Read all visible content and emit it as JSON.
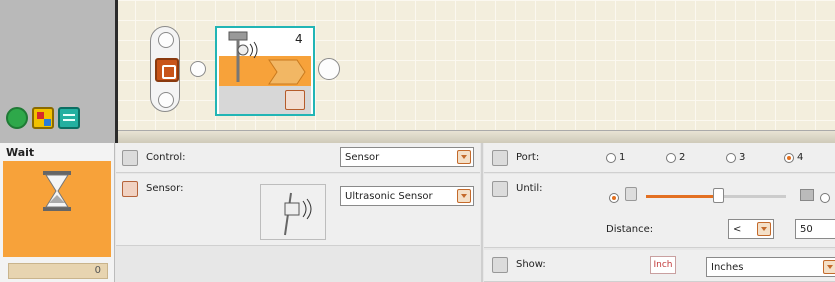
{
  "block": {
    "number": "4",
    "title": "Wait",
    "counter": "0"
  },
  "control": {
    "label": "Control:",
    "value": "Sensor"
  },
  "sensor": {
    "label": "Sensor:",
    "value": "Ultrasonic Sensor"
  },
  "port": {
    "label": "Port:",
    "options": [
      "1",
      "2",
      "3",
      "4"
    ],
    "selected": "4"
  },
  "until": {
    "label": "Until:",
    "distance_label": "Distance:",
    "comparator": "<",
    "distance_value": "50"
  },
  "show": {
    "label": "Show:",
    "unit_icon": "Inch",
    "unit_value": "Inches"
  },
  "colors": {
    "accent_orange": "#f7a23a",
    "selection_cyan": "#21b5b5"
  },
  "icons": [
    "eye-icon",
    "upload-icon",
    "ultrasonic-sensor-icon",
    "port-icon",
    "hourglass-icon",
    "display-icon"
  ]
}
